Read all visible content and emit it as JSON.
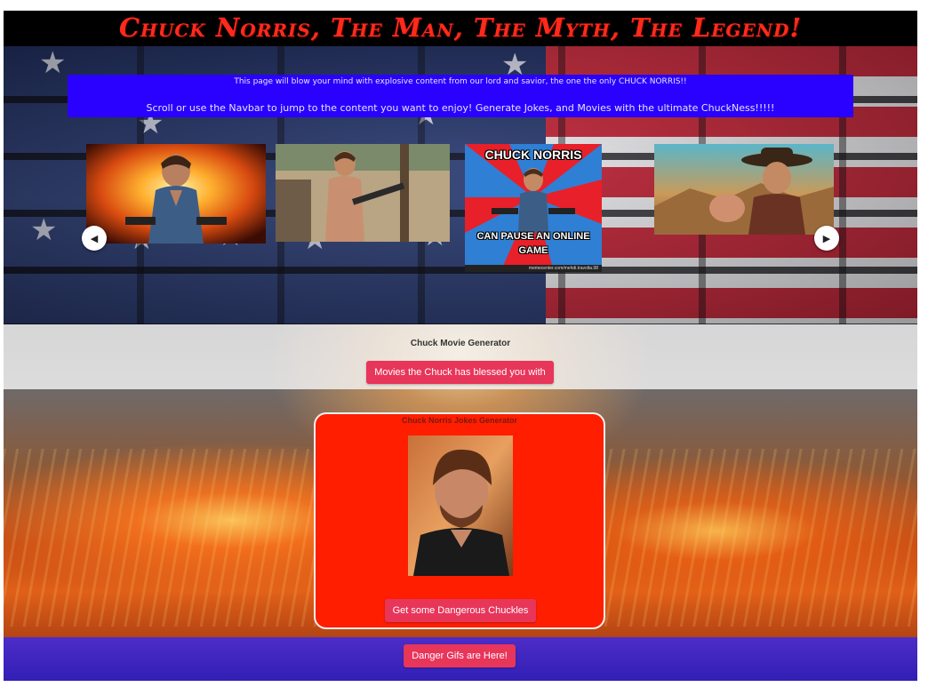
{
  "header": {
    "title": "Chuck Norris, The Man, The Myth, The Legend!"
  },
  "intro": {
    "line1": "This page will blow your mind with explosive content from our lord and savior, the one the only CHUCK NORRIS!!",
    "line2": "Scroll or use the Navbar to jump to the content you want to enjoy! Generate Jokes, and Movies with the ultimate ChuckNess!!!!!"
  },
  "carousel": {
    "slides": [
      {
        "icon": "explosion-action-photo"
      },
      {
        "icon": "shirtless-gun-photo"
      },
      {
        "icon": "meme-photo",
        "meme_top": "CHUCK NORRIS",
        "meme_bottom_1": "CAN PAUSE AN ONLINE",
        "meme_bottom_2": "GAME",
        "watermark": "memecenter.com/mehdi.travolta.98"
      },
      {
        "icon": "cowboy-pointing-photo"
      }
    ],
    "prev_icon": "chevron-left-icon",
    "next_icon": "chevron-right-icon",
    "prev_glyph": "◀",
    "next_glyph": "▶"
  },
  "movies": {
    "heading": "Chuck Movie Generator",
    "button_label": "Movies the Chuck has blessed you with"
  },
  "jokes": {
    "heading": "Chuck Norris Jokes Generator",
    "button_label": "Get some Dangerous Chuckles"
  },
  "gifs": {
    "button_label": "Danger Gifs are Here!"
  },
  "colors": {
    "title_red": "#ff2a1a",
    "intro_blue": "#2a00ff",
    "button_pink": "#e8355a",
    "card_red": "#ff1e00"
  }
}
